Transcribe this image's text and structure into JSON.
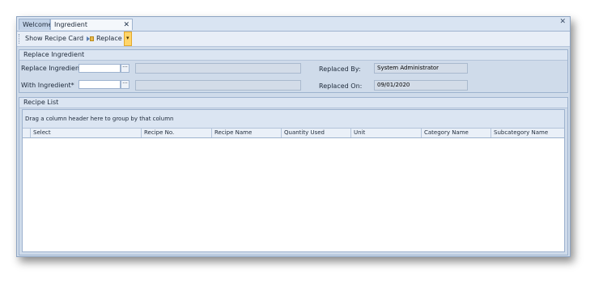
{
  "tabs": [
    {
      "label": "Welcome",
      "active": false
    },
    {
      "label": "Ingredient Replacement",
      "active": true,
      "close": "✕"
    }
  ],
  "window_close": "✕",
  "toolbar": {
    "show_recipe_card": "Show Recipe Card",
    "replace": "Replace",
    "dropdown_arrow": "▾"
  },
  "replace_section": {
    "title": "Replace Ingredient",
    "replace_label": "Replace Ingredient*",
    "replace_value": "",
    "replace_name": "",
    "with_label": "With Ingredient*",
    "with_value": "",
    "with_name": "",
    "ellipsis": "···",
    "replaced_by_label": "Replaced By:",
    "replaced_by_value": "System Administrator",
    "replaced_on_label": "Replaced On:",
    "replaced_on_value": "09/01/2020"
  },
  "recipe_list": {
    "title": "Recipe List",
    "group_hint": "Drag a column header here to group by that column",
    "columns": [
      "Select",
      "Recipe No.",
      "Recipe Name",
      "Quantity Used",
      "Unit",
      "Category Name",
      "Subcategory Name"
    ]
  },
  "colors": {
    "toolbar_split_highlight": "#ffd56a",
    "panel_background": "#cfdbea"
  }
}
